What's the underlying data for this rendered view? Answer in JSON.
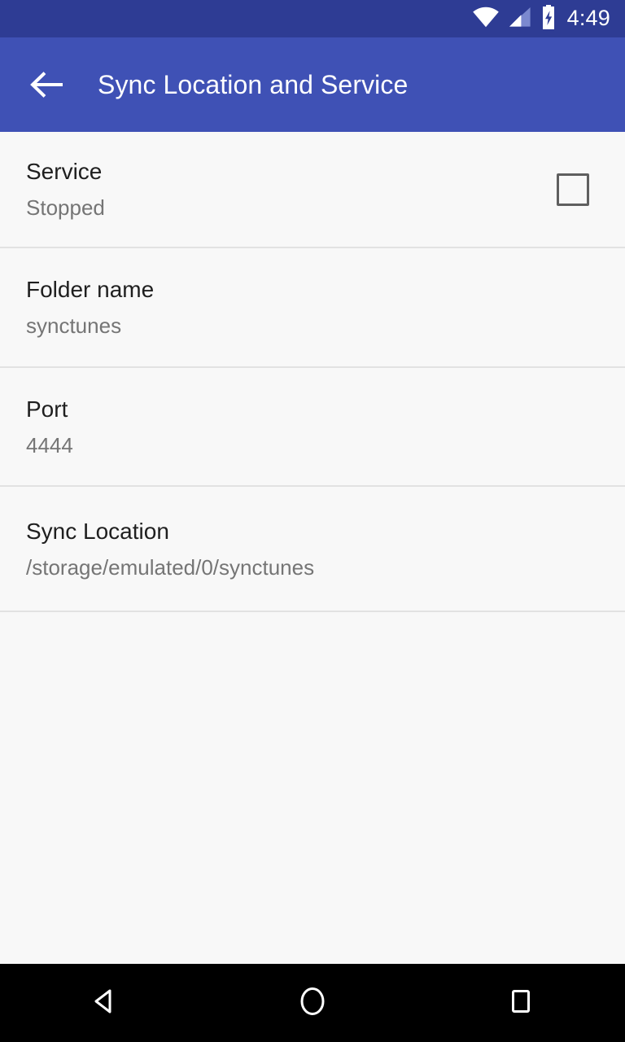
{
  "status_bar": {
    "time": "4:49",
    "background_color": "#2e3c94",
    "icons": [
      {
        "name": "wifi-icon",
        "label": "Wi-Fi connected"
      },
      {
        "name": "cellular-signal-icon",
        "label": "Cellular signal"
      },
      {
        "name": "battery-charging-icon",
        "label": "Battery charging"
      }
    ]
  },
  "app_bar": {
    "title": "Sync Location and Service",
    "back_label": "Navigate up",
    "background_color": "#3f51b5",
    "text_color": "#ffffff"
  },
  "list": {
    "background_color": "#f8f8f8",
    "divider_color": "#e2e2e2",
    "title_color": "#1f1f1f",
    "subtitle_color": "#757575",
    "rows": [
      {
        "key": "service",
        "title": "Service",
        "subtitle": "Stopped",
        "accessory": "checkbox",
        "checked": false
      },
      {
        "key": "folder-name",
        "title": "Folder name",
        "subtitle": "synctunes",
        "accessory": "none"
      },
      {
        "key": "port",
        "title": "Port",
        "subtitle": "4444",
        "accessory": "none"
      },
      {
        "key": "sync-location",
        "title": "Sync Location",
        "subtitle": "/storage/emulated/0/synctunes",
        "accessory": "none"
      }
    ]
  },
  "nav_bar": {
    "background_color": "#000000",
    "buttons": [
      {
        "name": "back-nav-icon",
        "label": "Back"
      },
      {
        "name": "home-nav-icon",
        "label": "Home"
      },
      {
        "name": "recents-nav-icon",
        "label": "Recent apps"
      }
    ]
  }
}
